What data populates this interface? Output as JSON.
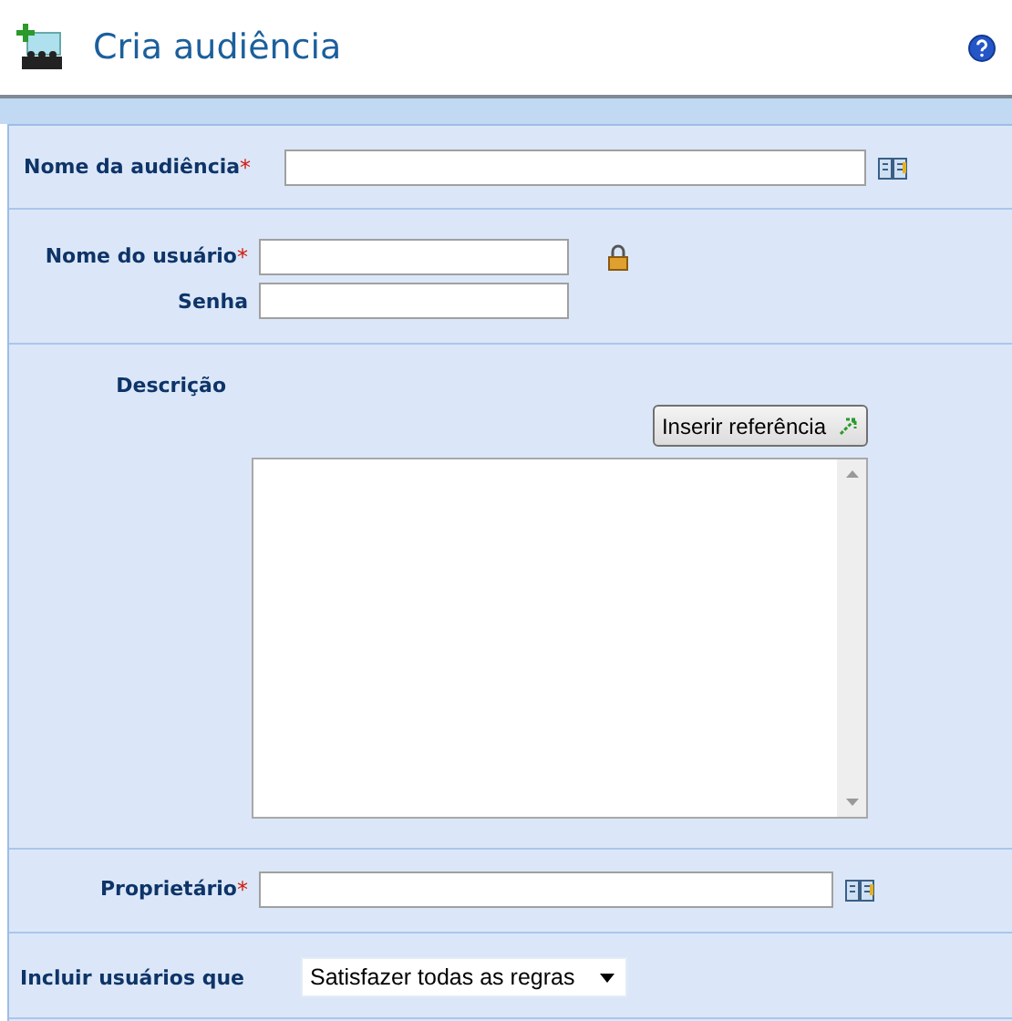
{
  "header": {
    "title": "Cria audiência"
  },
  "sections": [
    {
      "rows": [
        {
          "kind": "text",
          "label": "Nome da audiência",
          "required_mark": "*",
          "trailing": {
            "kind": "book"
          }
        }
      ]
    },
    {
      "rows": [
        {
          "kind": "text",
          "label": "Nome do usuário",
          "required_mark": "*",
          "trailing": {
            "kind": "lock"
          }
        },
        {
          "kind": "text",
          "label": "Senha"
        }
      ]
    },
    {
      "rows": [
        {
          "kind": "textarea",
          "label": "Descrição",
          "button": "Inserir referência"
        }
      ]
    },
    {
      "rows": [
        {
          "kind": "text",
          "label": "Proprietário",
          "required_mark": "*",
          "trailing": {
            "kind": "book"
          }
        }
      ]
    },
    {
      "rows": [
        {
          "kind": "select",
          "label": "Incluir usuários que",
          "value": "Satisfazer todas as regras"
        }
      ]
    }
  ]
}
